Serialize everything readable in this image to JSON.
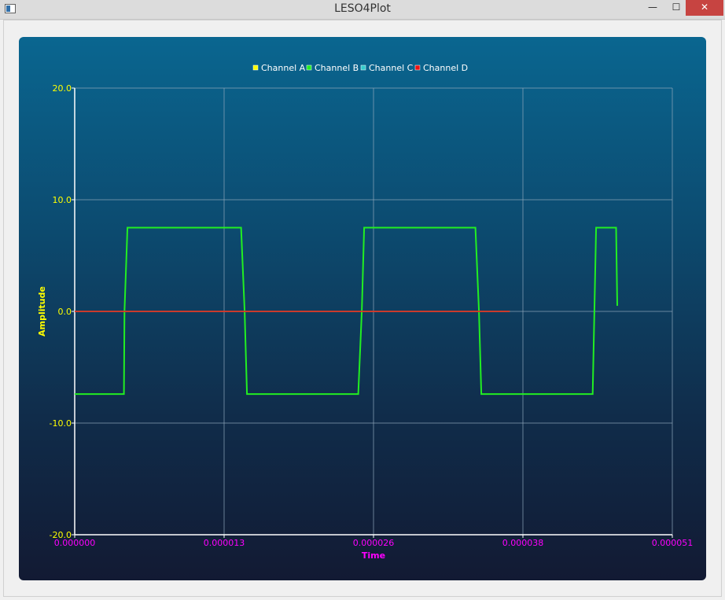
{
  "window": {
    "title": "LESO4Plot",
    "min_icon": "minimize-icon",
    "max_icon": "maximize-icon",
    "close_icon": "close-icon",
    "min_glyph": "—",
    "max_glyph": "☐",
    "close_glyph": "✕"
  },
  "chart_data": {
    "type": "line",
    "xlabel": "Time",
    "ylabel": "Amplitude",
    "xlim": [
      0.0,
      5.1e-05
    ],
    "ylim": [
      -20.0,
      20.0
    ],
    "x_ticks": [
      "0.000000",
      "0.000013",
      "0.000026",
      "0.000038",
      "0.000051"
    ],
    "y_ticks": [
      "20.0",
      "10.0",
      "0.0",
      "-10.0",
      "-20.0"
    ],
    "grid": true,
    "legend_position": "top-center",
    "series": [
      {
        "name": "Channel A",
        "color": "#ffff00",
        "x": [
          0.0,
          3.713e-05
        ],
        "y": [
          0.0,
          0.0
        ]
      },
      {
        "name": "Channel B",
        "color": "#22ee22",
        "x": [
          0.0,
          4.2e-06,
          4.25e-06,
          4.5e-06,
          1.42e-05,
          1.45e-05,
          1.47e-05,
          2.42e-05,
          2.45e-05,
          2.47e-05,
          3.42e-05,
          3.45e-05,
          3.47e-05,
          4.42e-05,
          4.45e-05,
          4.62e-05,
          4.63e-05
        ],
        "y": [
          -7.4,
          -7.4,
          0.0,
          7.5,
          7.5,
          0.0,
          -7.4,
          -7.4,
          0.0,
          7.5,
          7.5,
          0.0,
          -7.4,
          -7.4,
          7.5,
          7.5,
          0.5
        ]
      },
      {
        "name": "Channel C",
        "color": "#33cccc",
        "x": [
          0.0,
          3.713e-05
        ],
        "y": [
          0.0,
          0.0
        ]
      },
      {
        "name": "Channel D",
        "color": "#ee1111",
        "x": [
          0.0,
          3.713e-05
        ],
        "y": [
          0.0,
          0.0
        ]
      }
    ]
  }
}
